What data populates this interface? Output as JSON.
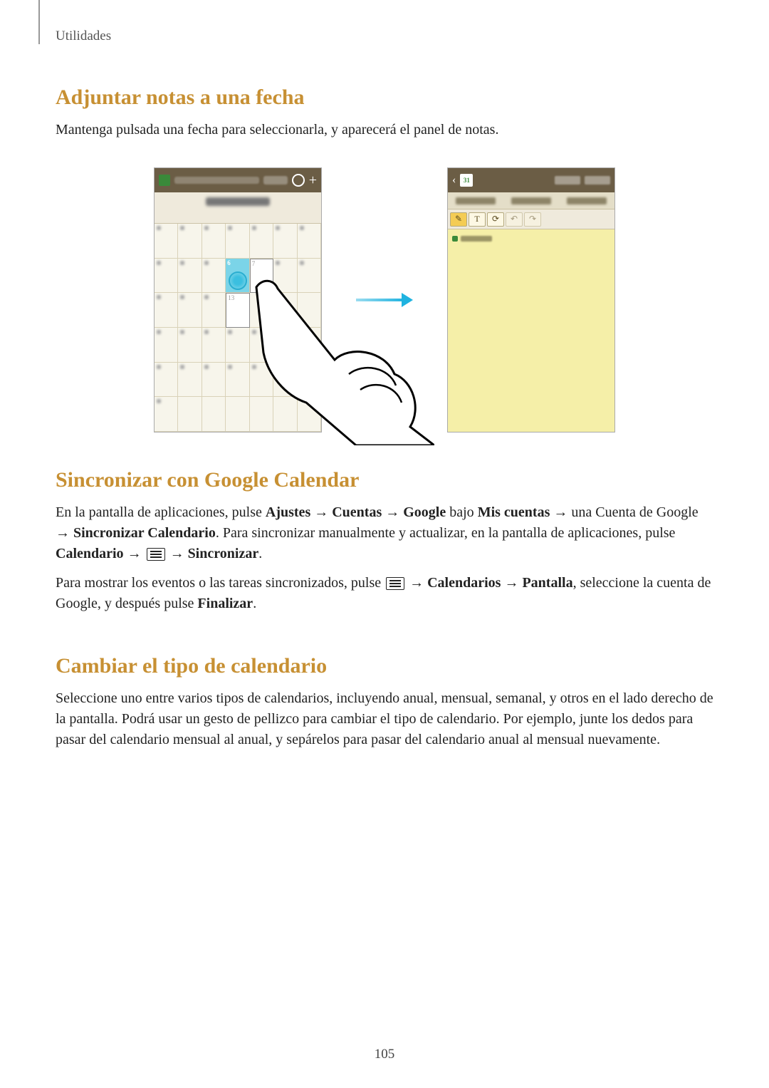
{
  "running_head": "Utilidades",
  "section1": {
    "title": "Adjuntar notas a una fecha",
    "body": "Mantenga pulsada una fecha para seleccionarla, y aparecerá el panel de notas."
  },
  "figure": {
    "calendar": {
      "highlighted_day_a": "6",
      "highlighted_day_b": "7",
      "highlighted_day_c": "13",
      "date_badge": "31"
    },
    "notes_toolbar_text_glyph": "T"
  },
  "section2": {
    "title": "Sincronizar con Google Calendar",
    "p1_a": "En la pantalla de aplicaciones, pulse ",
    "p1_b1": "Ajustes",
    "p1_arrow": " → ",
    "p1_b2": "Cuentas",
    "p1_b3": "Google",
    "p1_c": " bajo ",
    "p1_b4": "Mis cuentas",
    "p1_d": " → una Cuenta de Google → ",
    "p1_b5": "Sincronizar Calendario",
    "p1_e": ". Para sincronizar manualmente y actualizar, en la pantalla de aplicaciones, pulse ",
    "p1_b6": "Calendario",
    "p1_b7": "Sincronizar",
    "p1_f": ".",
    "p2_a": "Para mostrar los eventos o las tareas sincronizados, pulse ",
    "p2_b1": "Calendarios",
    "p2_b2": "Pantalla",
    "p2_c": ", seleccione la cuenta de Google, y después pulse ",
    "p2_b3": "Finalizar",
    "p2_d": "."
  },
  "section3": {
    "title": "Cambiar el tipo de calendario",
    "body": "Seleccione uno entre varios tipos de calendarios, incluyendo anual, mensual, semanal, y otros en el lado derecho de la pantalla. Podrá usar un gesto de pellizco para cambiar el tipo de calendario. Por ejemplo, junte los dedos para pasar del calendario mensual al anual, y sepárelos para pasar del calendario anual al mensual nuevamente."
  },
  "page_number": "105"
}
